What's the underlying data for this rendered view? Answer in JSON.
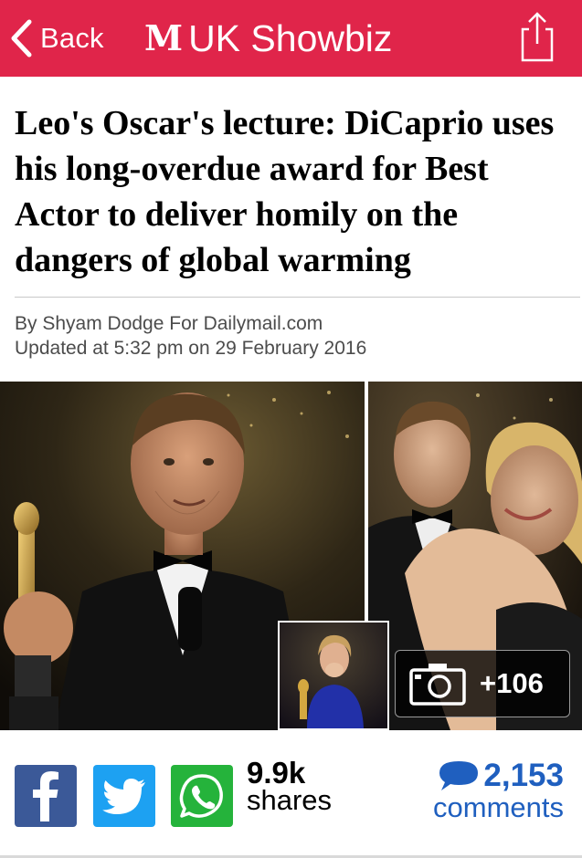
{
  "header": {
    "back_label": "Back",
    "brand_logo": "M",
    "section_title": "UK Showbiz",
    "background_color": "#e0254a",
    "icons": {
      "back": "chevron-left-icon",
      "share": "share-icon"
    }
  },
  "article": {
    "headline": "Leo's Oscar's lecture: DiCaprio uses his long-overdue award for Best Actor to deliver homily on the dangers of global warming",
    "byline": "By Shyam Dodge For Dailymail.com",
    "updated": "Updated at 5:32 pm on 29 February 2016"
  },
  "gallery": {
    "count_label": "+106",
    "icon": "camera-icon"
  },
  "social": {
    "buttons": [
      "facebook",
      "twitter",
      "whatsapp"
    ],
    "colors": {
      "facebook": "#3b5998",
      "twitter": "#1da1f2",
      "whatsapp": "#25b33b"
    },
    "shares_count": "9.9k",
    "shares_label": "shares",
    "comments_count": "2,153",
    "comments_label": "comments",
    "comments_color": "#1f5fbf"
  }
}
